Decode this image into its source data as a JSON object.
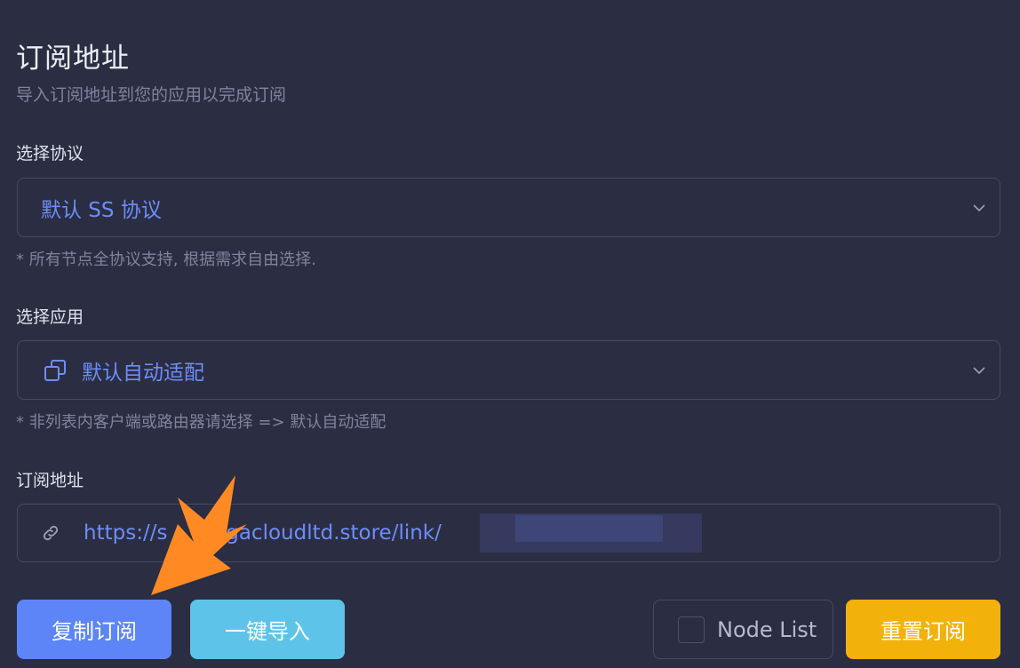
{
  "header": {
    "title": "订阅地址",
    "subtitle": "导入订阅地址到您的应用以完成订阅"
  },
  "protocol": {
    "label": "选择协议",
    "value": "默认 SS 协议",
    "hint": "* 所有节点全协议支持, 根据需求自由选择."
  },
  "app": {
    "label": "选择应用",
    "value": "默认自动适配",
    "hint": "* 非列表内客户端或路由器请选择 => 默认自动适配",
    "icon": "app-window-icon"
  },
  "subscription": {
    "label": "订阅地址",
    "url": "https://s        .gacloudltd.store/link/",
    "icon": "link-icon"
  },
  "actions": {
    "copy_label": "复制订阅",
    "import_label": "一键导入",
    "node_list_label": "Node List",
    "node_list_checked": false,
    "reset_label": "重置订阅"
  },
  "colors": {
    "background": "#2b2d42",
    "accent": "#6e8dfa",
    "copy_button": "#5d85f7",
    "import_button": "#5ec3e9",
    "reset_button": "#f2b20a",
    "annotation_arrow": "#ff8a24"
  }
}
